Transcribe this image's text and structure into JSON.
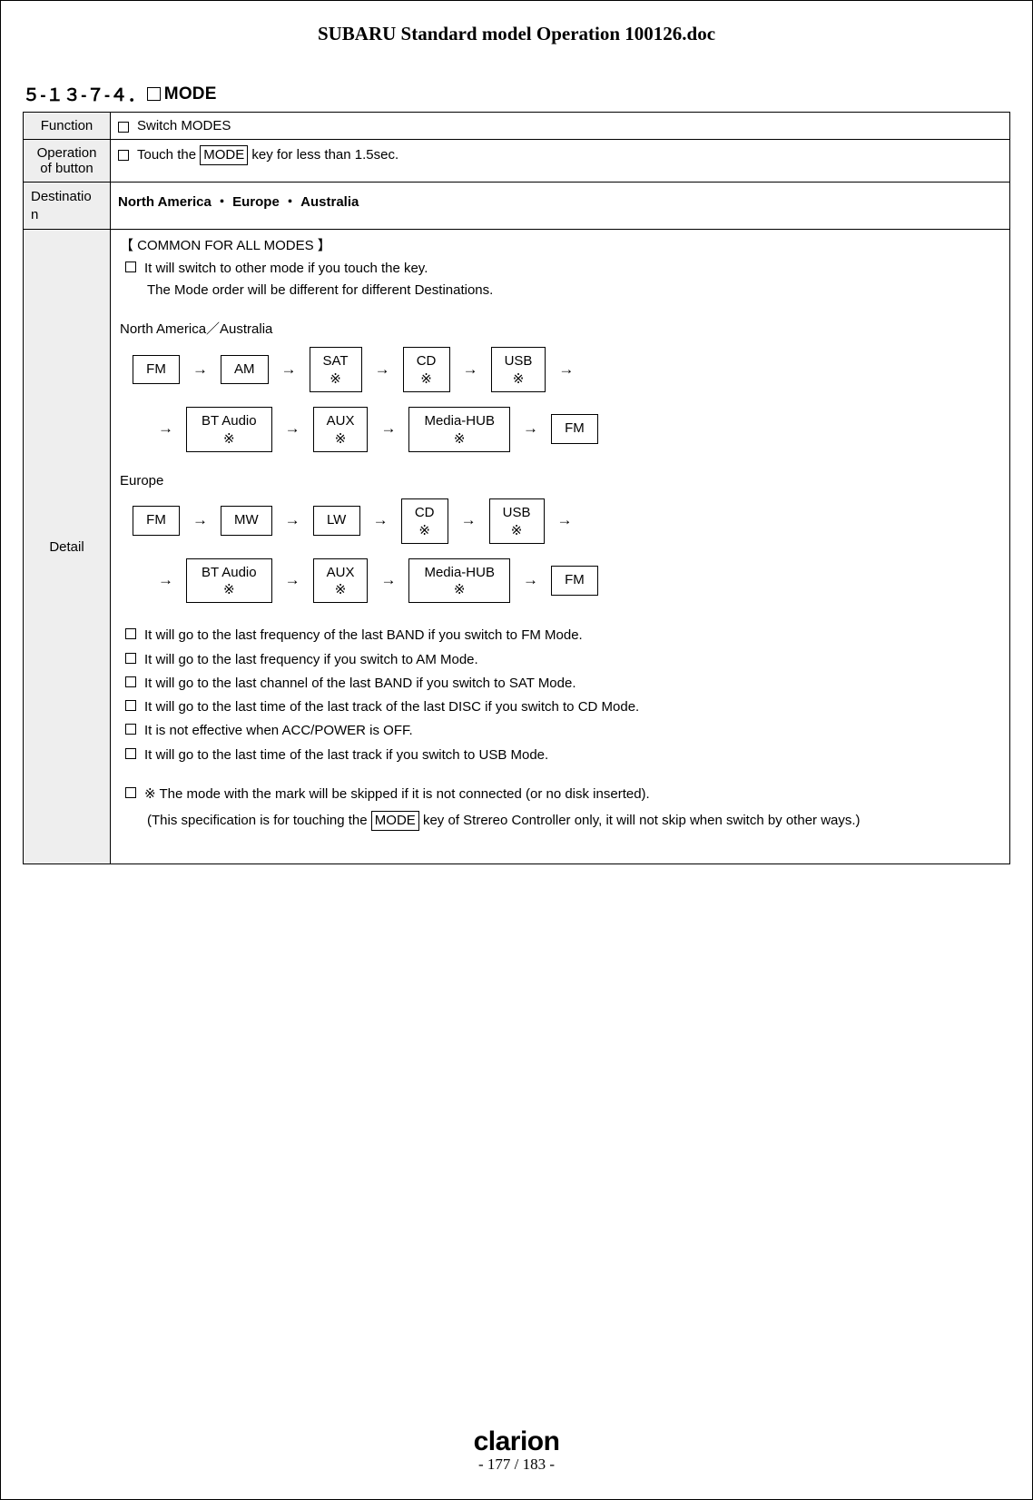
{
  "doc_title": "SUBARU Standard model Operation 100126.doc",
  "heading_number": "５-１３-７-４．",
  "heading_text": "MODE",
  "rows": {
    "function": {
      "label": "Function",
      "value": "Switch MODES"
    },
    "operation": {
      "label": "Operation of button",
      "pre": "Touch the ",
      "key": "MODE",
      "post": " key for less than 1.5sec."
    },
    "destination": {
      "label": "Destinatio\nn",
      "value": "North America  ・  Europe  ・  Australia"
    },
    "detail": {
      "label": "Detail"
    }
  },
  "detail": {
    "common_header": "【 COMMON FOR ALL MODES 】",
    "intro_line": "It will switch to other mode if you touch the key.",
    "intro_sub": "The Mode order will be different for different Destinations.",
    "regions": [
      {
        "label": "North America／Australia",
        "row1": [
          {
            "t": "FM"
          },
          {
            "t": "AM"
          },
          {
            "t": "SAT",
            "star": true
          },
          {
            "t": "CD",
            "star": true
          },
          {
            "t": "USB",
            "star": true
          }
        ],
        "row2": [
          {
            "t": "BT Audio",
            "star": true,
            "wide": true
          },
          {
            "t": "AUX",
            "star": true
          },
          {
            "t": "Media-HUB",
            "star": true,
            "wide": true
          },
          {
            "t": "FM"
          }
        ]
      },
      {
        "label": "Europe",
        "row1": [
          {
            "t": "FM"
          },
          {
            "t": "MW"
          },
          {
            "t": "LW"
          },
          {
            "t": "CD",
            "star": true
          },
          {
            "t": "USB",
            "star": true
          }
        ],
        "row2": [
          {
            "t": "BT Audio",
            "star": true,
            "wide": true
          },
          {
            "t": "AUX",
            "star": true
          },
          {
            "t": "Media-HUB",
            "star": true,
            "wide": true
          },
          {
            "t": "FM"
          }
        ]
      }
    ],
    "bullets": [
      "It will go to the last frequency of the last BAND if you switch to FM Mode.",
      "It will go to the last frequency if you switch to AM Mode.",
      "It will go to the last channel of the last BAND if you switch to SAT Mode.",
      "It will go to the last time of the last track of the last DISC if you switch to CD Mode.",
      "It is not effective when ACC/POWER is OFF.",
      "It will go to the last time of the last track if you switch to USB Mode."
    ],
    "skip_note": "※ The mode with the mark will be skipped if it is not connected (or no disk inserted).",
    "paren_pre": "(This specification is for touching the ",
    "paren_key": "MODE",
    "paren_post": " key of Strereo Controller only, it will not skip when switch by other ways.)"
  },
  "footer": {
    "brand": "clarion",
    "pager": "- 177 / 183 -"
  },
  "glyphs": {
    "arrow": "→",
    "star": "※"
  }
}
